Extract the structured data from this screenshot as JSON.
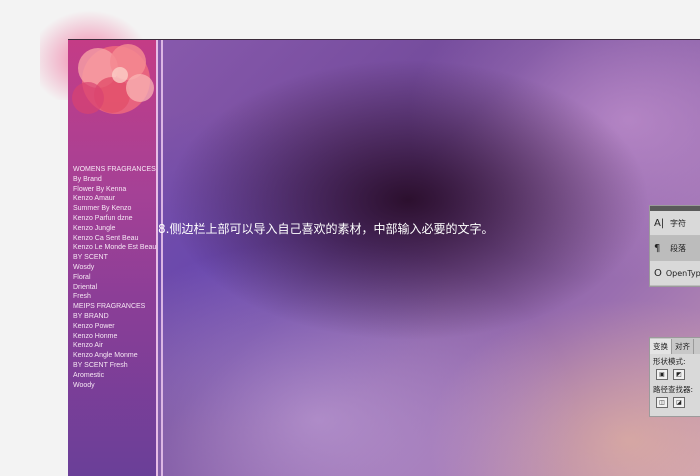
{
  "sidebar": {
    "items": [
      "WOMENS FRAGRANCES",
      "By Brand",
      "Flower By Kenna",
      "Kenzo Amaur",
      "Summer By Kenzo",
      "Kenzo Parfun dzne",
      "Kenzo Jungle",
      "Kenzo Ca Sent Beau",
      "Kenzo Le Monde Est Beau",
      "BY SCENT",
      "Wosdy",
      "Floral",
      "Driental",
      "Fresh",
      "MEIPS FRAGRANCES",
      "BY BRAND",
      "Kenzo Power",
      "Kenzo Honme",
      "Kenzo Air",
      "Kenzo Angle Monme",
      "BY SCENT Fresh",
      "Aromestic",
      "Woody"
    ]
  },
  "caption": "8.侧边栏上部可以导入自己喜欢的素材，中部输入必要的文字。",
  "char_panel": {
    "items": [
      {
        "icon": "character-icon",
        "glyph": "A|",
        "label": "字符"
      },
      {
        "icon": "paragraph-icon",
        "glyph": "¶",
        "label": "段落"
      },
      {
        "icon": "opentype-icon",
        "glyph": "O",
        "label": "OpenType"
      }
    ]
  },
  "pathfinder_panel": {
    "tabs": [
      "变换",
      "对齐"
    ],
    "shape_modes_label": "形状模式:",
    "pathfinders_label": "路径查找器:"
  }
}
